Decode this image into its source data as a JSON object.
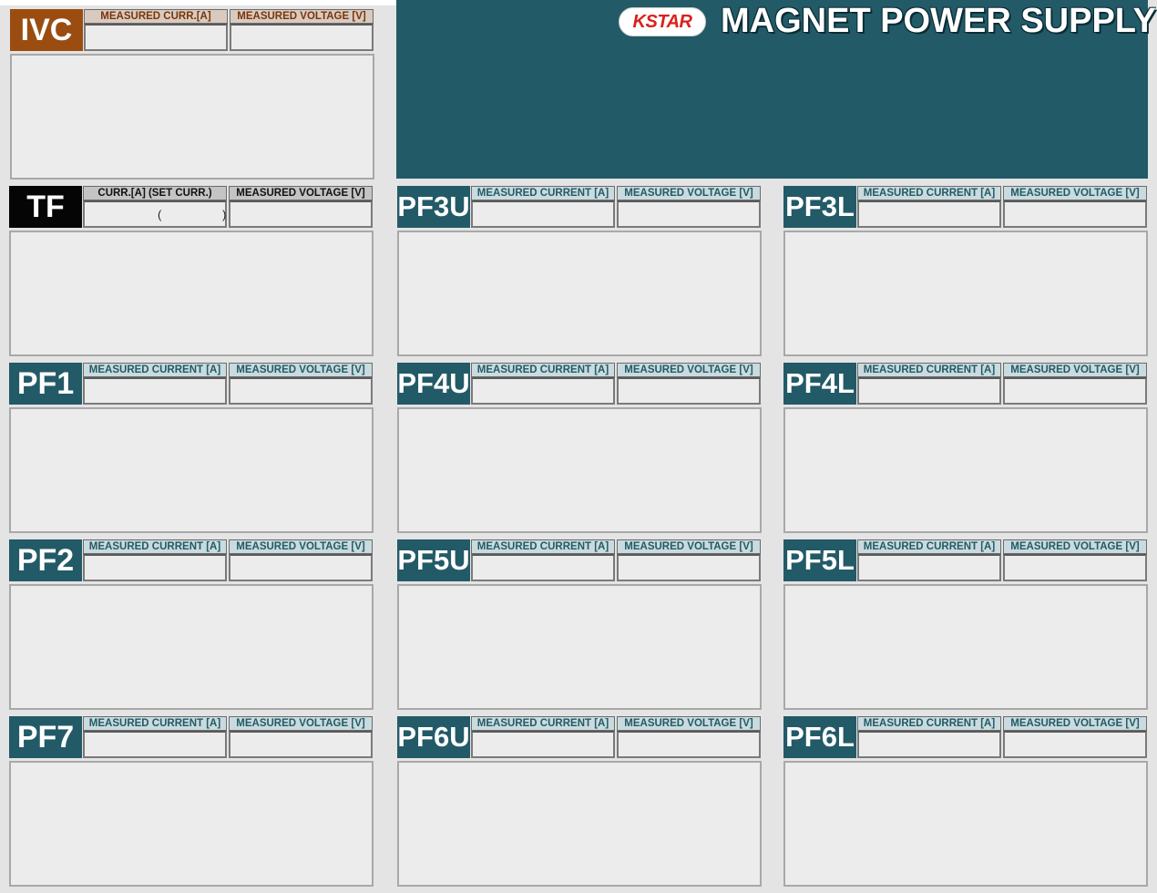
{
  "header": {
    "logo": "KSTAR",
    "title": "MAGNET POWER SUPPLY"
  },
  "colors": {
    "teal": "#235a67",
    "ivc": "#9b4d11",
    "tf": "#050505",
    "logo_red": "#d9221c"
  },
  "panels": {
    "ivc": {
      "name": "IVC",
      "col1": "MEASURED CURR.[A]",
      "col2": "MEASURED VOLTAGE [V]"
    },
    "tf": {
      "name": "TF",
      "col1": "CURR.[A] (SET CURR.)",
      "col2": "MEASURED VOLTAGE [V]",
      "paren_open": "(",
      "paren_close": ")"
    },
    "pf3u": {
      "name": "PF3U",
      "col1": "MEASURED CURRENT [A]",
      "col2": "MEASURED VOLTAGE [V]"
    },
    "pf3l": {
      "name": "PF3L",
      "col1": "MEASURED CURRENT [A]",
      "col2": "MEASURED VOLTAGE [V]"
    },
    "pf1": {
      "name": "PF1",
      "col1": "MEASURED CURRENT [A]",
      "col2": "MEASURED VOLTAGE [V]"
    },
    "pf4u": {
      "name": "PF4U",
      "col1": "MEASURED CURRENT [A]",
      "col2": "MEASURED VOLTAGE [V]"
    },
    "pf4l": {
      "name": "PF4L",
      "col1": "MEASURED CURRENT [A]",
      "col2": "MEASURED VOLTAGE [V]"
    },
    "pf2": {
      "name": "PF2",
      "col1": "MEASURED CURRENT [A]",
      "col2": "MEASURED VOLTAGE [V]"
    },
    "pf5u": {
      "name": "PF5U",
      "col1": "MEASURED CURRENT [A]",
      "col2": "MEASURED VOLTAGE [V]"
    },
    "pf5l": {
      "name": "PF5L",
      "col1": "MEASURED CURRENT [A]",
      "col2": "MEASURED VOLTAGE [V]"
    },
    "pf7": {
      "name": "PF7",
      "col1": "MEASURED CURRENT [A]",
      "col2": "MEASURED VOLTAGE [V]"
    },
    "pf6u": {
      "name": "PF6U",
      "col1": "MEASURED CURRENT [A]",
      "col2": "MEASURED VOLTAGE [V]"
    },
    "pf6l": {
      "name": "PF6L",
      "col1": "MEASURED CURRENT [A]",
      "col2": "MEASURED VOLTAGE [V]"
    }
  }
}
